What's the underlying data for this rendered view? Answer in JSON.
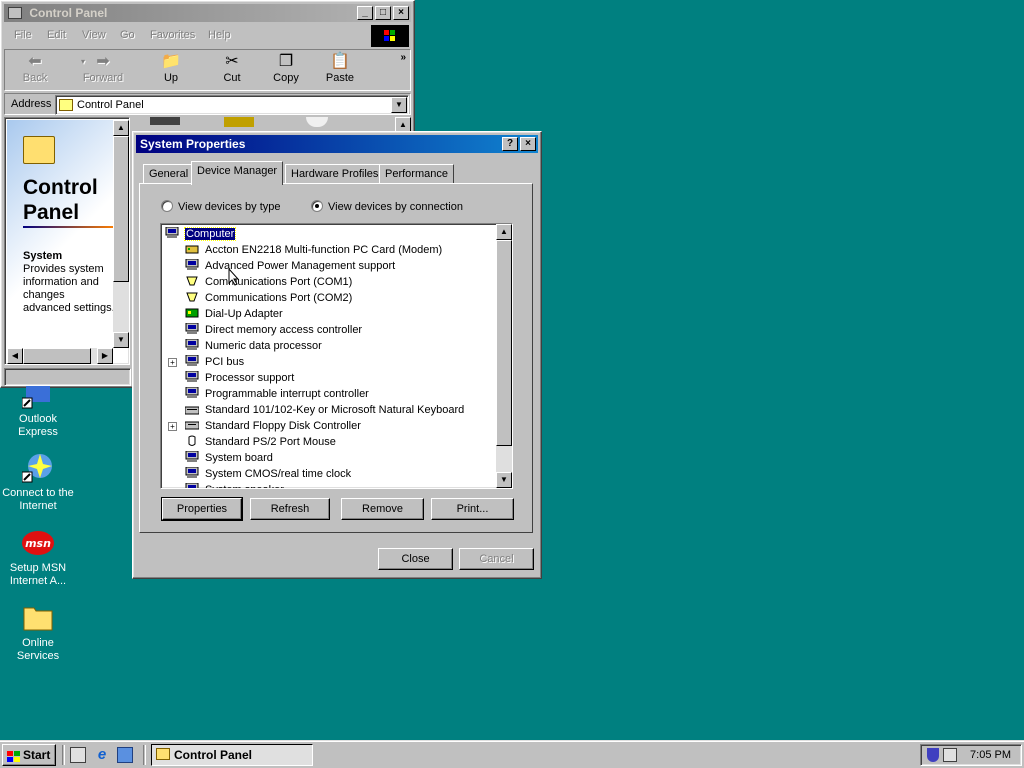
{
  "control_panel": {
    "title": "Control Panel",
    "menu": [
      "File",
      "Edit",
      "View",
      "Go",
      "Favorites",
      "Help"
    ],
    "toolbar": {
      "back": "Back",
      "forward": "Forward",
      "up": "Up",
      "cut": "Cut",
      "copy": "Copy",
      "paste": "Paste"
    },
    "address_label": "Address",
    "address_value": "Control Panel",
    "heading_line1": "Control",
    "heading_line2": "Panel",
    "selected_item": "System",
    "description": "Provides system information and changes advanced settings."
  },
  "desktop_icons": [
    {
      "label": "Outlook Express",
      "icon": "outlook-express-icon"
    },
    {
      "label": "Connect to the Internet",
      "icon": "connect-internet-icon"
    },
    {
      "label": "Setup MSN Internet A...",
      "icon": "msn-icon"
    },
    {
      "label": "Online Services",
      "icon": "folder-icon"
    }
  ],
  "system_properties": {
    "title": "System Properties",
    "tabs": [
      "General",
      "Device Manager",
      "Hardware Profiles",
      "Performance"
    ],
    "selected_tab": "Device Manager",
    "view_by_type": "View devices by type",
    "view_by_connection": "View devices by connection",
    "selected_view": "connection",
    "tree": {
      "root": "Computer",
      "items": [
        {
          "label": "Accton EN2218 Multi-function PC Card (Modem)",
          "icon": "modem-icon",
          "expandable": false
        },
        {
          "label": "Advanced Power Management support",
          "icon": "system-device-icon",
          "expandable": false
        },
        {
          "label": "Communications Port (COM1)",
          "icon": "port-icon",
          "expandable": false
        },
        {
          "label": "Communications Port (COM2)",
          "icon": "port-icon",
          "expandable": false
        },
        {
          "label": "Dial-Up Adapter",
          "icon": "network-adapter-icon",
          "expandable": false
        },
        {
          "label": "Direct memory access controller",
          "icon": "system-device-icon",
          "expandable": false
        },
        {
          "label": "Numeric data processor",
          "icon": "system-device-icon",
          "expandable": false
        },
        {
          "label": "PCI bus",
          "icon": "system-device-icon",
          "expandable": true
        },
        {
          "label": "Processor support",
          "icon": "system-device-icon",
          "expandable": false
        },
        {
          "label": "Programmable interrupt controller",
          "icon": "system-device-icon",
          "expandable": false
        },
        {
          "label": "Standard 101/102-Key or Microsoft Natural Keyboard",
          "icon": "keyboard-icon",
          "expandable": false
        },
        {
          "label": "Standard Floppy Disk Controller",
          "icon": "floppy-controller-icon",
          "expandable": true
        },
        {
          "label": "Standard PS/2 Port Mouse",
          "icon": "mouse-icon",
          "expandable": false
        },
        {
          "label": "System board",
          "icon": "system-device-icon",
          "expandable": false
        },
        {
          "label": "System CMOS/real time clock",
          "icon": "system-device-icon",
          "expandable": false
        },
        {
          "label": "System speaker",
          "icon": "system-device-icon",
          "expandable": false
        }
      ]
    },
    "buttons": {
      "properties": "Properties",
      "refresh": "Refresh",
      "remove": "Remove",
      "print": "Print...",
      "close": "Close",
      "cancel": "Cancel"
    }
  },
  "taskbar": {
    "start": "Start",
    "task": "Control Panel",
    "clock": "7:05 PM"
  },
  "colors": {
    "desktop": "#008080",
    "active_title": "#000080",
    "face": "#c0c0c0"
  }
}
